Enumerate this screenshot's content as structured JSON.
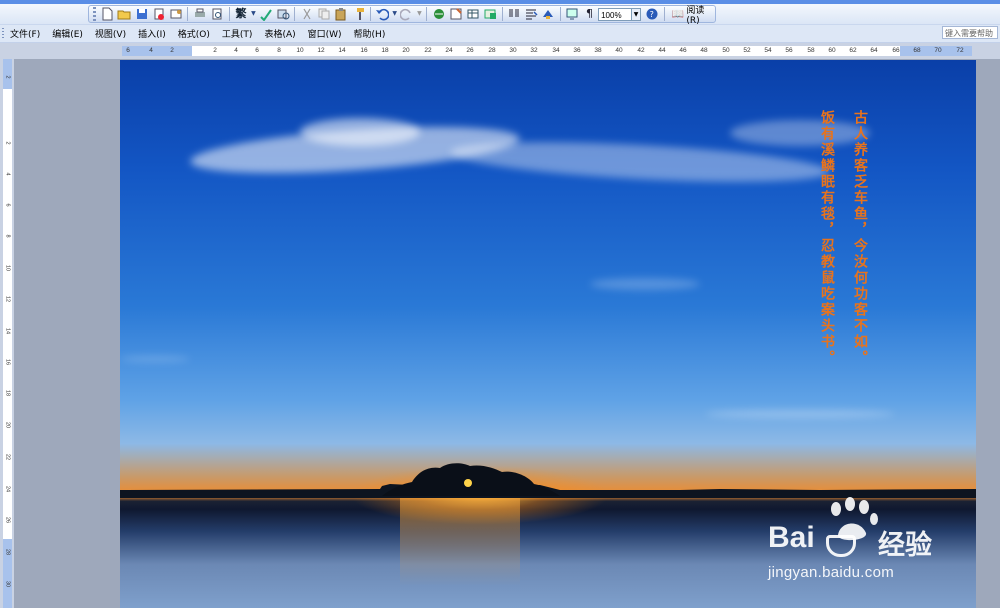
{
  "toolbar": {
    "zoom": "100%",
    "read_label": "阅读(R)"
  },
  "menu": {
    "items": [
      "文件(F)",
      "编辑(E)",
      "视图(V)",
      "插入(I)",
      "格式(O)",
      "工具(T)",
      "表格(A)",
      "窗口(W)",
      "帮助(H)"
    ],
    "help_placeholder": "键入需要帮助"
  },
  "hruler": {
    "labels": [
      "6",
      "4",
      "2",
      "2",
      "4",
      "6",
      "8",
      "10",
      "12",
      "14",
      "16",
      "18",
      "20",
      "22",
      "24",
      "26",
      "28",
      "30",
      "32",
      "34",
      "36",
      "38",
      "40",
      "42",
      "44",
      "46",
      "48",
      "50",
      "52",
      "54",
      "56",
      "58",
      "60",
      "62",
      "64",
      "66",
      "68",
      "70",
      "72"
    ]
  },
  "vruler": {
    "labels": [
      "2",
      "2",
      "4",
      "6",
      "8",
      "10",
      "12",
      "14",
      "16",
      "18",
      "20",
      "22",
      "24",
      "26",
      "28",
      "30"
    ]
  },
  "document": {
    "poem_lines": [
      "古人养客乏车鱼，今汝何功客不如。",
      "饭有溪鳞眠有毯，忍教鼠吃案头书。"
    ]
  },
  "watermark": {
    "brand": "Bai",
    "brand_cn": "经验",
    "url": "jingyan.baidu.com"
  },
  "colors": {
    "poem_text": "#e8731c",
    "ruler_margin": "#a8c2ec",
    "app_frame": "#9ea8bb"
  }
}
